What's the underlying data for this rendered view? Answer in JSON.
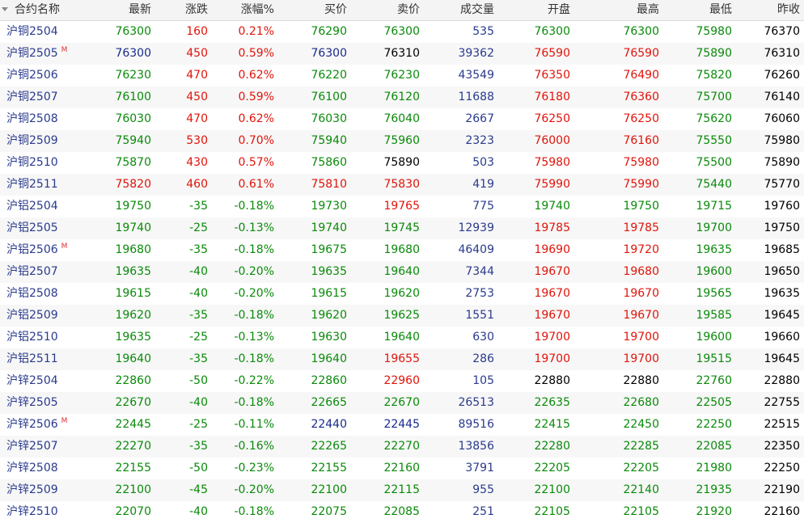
{
  "columns": {
    "name": "合约名称",
    "last": "最新",
    "change": "涨跌",
    "pct": "涨幅%",
    "bid": "买价",
    "ask": "卖价",
    "volume": "成交量",
    "open": "开盘",
    "high": "最高",
    "low": "最低",
    "prev_close": "昨收"
  },
  "colors": {
    "up": "#e0140a",
    "down": "#0a8a0a",
    "flat": "#000000",
    "volume": "#2a3a8c",
    "name": "#2a3a8c",
    "mark": "#e03030"
  },
  "rows": [
    {
      "name": "沪铜2504",
      "mark": "",
      "last": "76300",
      "change": "160",
      "pct": "0.21%",
      "bid": "76290",
      "ask": "76300",
      "volume": "535",
      "open": "76300",
      "high": "76300",
      "low": "75980",
      "prev_close": "76370"
    },
    {
      "name": "沪铜2505",
      "mark": "M",
      "last": "76300",
      "change": "450",
      "pct": "0.59%",
      "bid": "76300",
      "ask": "76310",
      "volume": "39362",
      "open": "76590",
      "high": "76590",
      "low": "75890",
      "prev_close": "76310"
    },
    {
      "name": "沪铜2506",
      "mark": "",
      "last": "76230",
      "change": "470",
      "pct": "0.62%",
      "bid": "76220",
      "ask": "76230",
      "volume": "43549",
      "open": "76350",
      "high": "76490",
      "low": "75820",
      "prev_close": "76260"
    },
    {
      "name": "沪铜2507",
      "mark": "",
      "last": "76100",
      "change": "450",
      "pct": "0.59%",
      "bid": "76100",
      "ask": "76120",
      "volume": "11688",
      "open": "76180",
      "high": "76360",
      "low": "75700",
      "prev_close": "76140"
    },
    {
      "name": "沪铜2508",
      "mark": "",
      "last": "76030",
      "change": "470",
      "pct": "0.62%",
      "bid": "76030",
      "ask": "76040",
      "volume": "2667",
      "open": "76250",
      "high": "76250",
      "low": "75620",
      "prev_close": "76060"
    },
    {
      "name": "沪铜2509",
      "mark": "",
      "last": "75940",
      "change": "530",
      "pct": "0.70%",
      "bid": "75940",
      "ask": "75960",
      "volume": "2323",
      "open": "76000",
      "high": "76160",
      "low": "75550",
      "prev_close": "75980"
    },
    {
      "name": "沪铜2510",
      "mark": "",
      "last": "75870",
      "change": "430",
      "pct": "0.57%",
      "bid": "75860",
      "ask": "75890",
      "volume": "503",
      "open": "75980",
      "high": "75980",
      "low": "75500",
      "prev_close": "75890"
    },
    {
      "name": "沪铜2511",
      "mark": "",
      "last": "75820",
      "change": "460",
      "pct": "0.61%",
      "bid": "75810",
      "ask": "75830",
      "volume": "419",
      "open": "75990",
      "high": "75990",
      "low": "75440",
      "prev_close": "75770"
    },
    {
      "name": "沪铝2504",
      "mark": "",
      "last": "19750",
      "change": "-35",
      "pct": "-0.18%",
      "bid": "19730",
      "ask": "19765",
      "volume": "775",
      "open": "19740",
      "high": "19750",
      "low": "19715",
      "prev_close": "19760"
    },
    {
      "name": "沪铝2505",
      "mark": "",
      "last": "19740",
      "change": "-25",
      "pct": "-0.13%",
      "bid": "19740",
      "ask": "19745",
      "volume": "12939",
      "open": "19785",
      "high": "19785",
      "low": "19700",
      "prev_close": "19750"
    },
    {
      "name": "沪铝2506",
      "mark": "M",
      "last": "19680",
      "change": "-35",
      "pct": "-0.18%",
      "bid": "19675",
      "ask": "19680",
      "volume": "46409",
      "open": "19690",
      "high": "19720",
      "low": "19635",
      "prev_close": "19685"
    },
    {
      "name": "沪铝2507",
      "mark": "",
      "last": "19635",
      "change": "-40",
      "pct": "-0.20%",
      "bid": "19635",
      "ask": "19640",
      "volume": "7344",
      "open": "19670",
      "high": "19680",
      "low": "19600",
      "prev_close": "19650"
    },
    {
      "name": "沪铝2508",
      "mark": "",
      "last": "19615",
      "change": "-40",
      "pct": "-0.20%",
      "bid": "19615",
      "ask": "19620",
      "volume": "2753",
      "open": "19670",
      "high": "19670",
      "low": "19565",
      "prev_close": "19635"
    },
    {
      "name": "沪铝2509",
      "mark": "",
      "last": "19620",
      "change": "-35",
      "pct": "-0.18%",
      "bid": "19620",
      "ask": "19625",
      "volume": "1551",
      "open": "19670",
      "high": "19670",
      "low": "19585",
      "prev_close": "19645"
    },
    {
      "name": "沪铝2510",
      "mark": "",
      "last": "19635",
      "change": "-25",
      "pct": "-0.13%",
      "bid": "19630",
      "ask": "19640",
      "volume": "630",
      "open": "19700",
      "high": "19700",
      "low": "19600",
      "prev_close": "19660"
    },
    {
      "name": "沪铝2511",
      "mark": "",
      "last": "19640",
      "change": "-35",
      "pct": "-0.18%",
      "bid": "19640",
      "ask": "19655",
      "volume": "286",
      "open": "19700",
      "high": "19700",
      "low": "19515",
      "prev_close": "19645"
    },
    {
      "name": "沪锌2504",
      "mark": "",
      "last": "22860",
      "change": "-50",
      "pct": "-0.22%",
      "bid": "22860",
      "ask": "22960",
      "volume": "105",
      "open": "22880",
      "high": "22880",
      "low": "22760",
      "prev_close": "22880"
    },
    {
      "name": "沪锌2505",
      "mark": "",
      "last": "22670",
      "change": "-40",
      "pct": "-0.18%",
      "bid": "22665",
      "ask": "22670",
      "volume": "26513",
      "open": "22635",
      "high": "22680",
      "low": "22505",
      "prev_close": "22755"
    },
    {
      "name": "沪锌2506",
      "mark": "M",
      "last": "22445",
      "change": "-25",
      "pct": "-0.11%",
      "bid": "22440",
      "ask": "22445",
      "volume": "89516",
      "open": "22415",
      "high": "22450",
      "low": "22250",
      "prev_close": "22515"
    },
    {
      "name": "沪锌2507",
      "mark": "",
      "last": "22270",
      "change": "-35",
      "pct": "-0.16%",
      "bid": "22265",
      "ask": "22270",
      "volume": "13856",
      "open": "22280",
      "high": "22285",
      "low": "22085",
      "prev_close": "22350"
    },
    {
      "name": "沪锌2508",
      "mark": "",
      "last": "22155",
      "change": "-50",
      "pct": "-0.23%",
      "bid": "22155",
      "ask": "22160",
      "volume": "3791",
      "open": "22205",
      "high": "22205",
      "low": "21980",
      "prev_close": "22250"
    },
    {
      "name": "沪锌2509",
      "mark": "",
      "last": "22100",
      "change": "-45",
      "pct": "-0.20%",
      "bid": "22100",
      "ask": "22115",
      "volume": "955",
      "open": "22100",
      "high": "22140",
      "low": "21935",
      "prev_close": "22190"
    },
    {
      "name": "沪锌2510",
      "mark": "",
      "last": "22070",
      "change": "-40",
      "pct": "-0.18%",
      "bid": "22075",
      "ask": "22085",
      "volume": "251",
      "open": "22105",
      "high": "22105",
      "low": "21920",
      "prev_close": "22160"
    }
  ]
}
